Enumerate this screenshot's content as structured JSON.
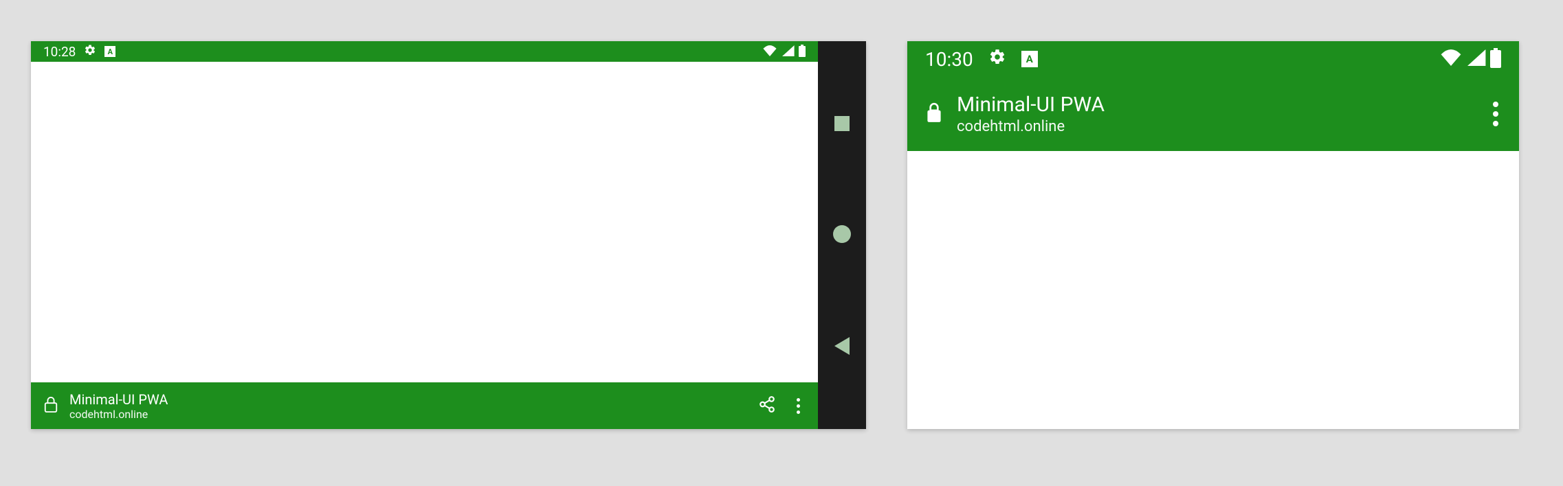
{
  "colors": {
    "theme": "#1d8e1d",
    "navbar": "#1c1c1c",
    "navbtn": "#a8c8a8"
  },
  "left_device": {
    "status": {
      "time": "10:28"
    },
    "content": "",
    "bottom_bar": {
      "title": "Minimal-UI PWA",
      "host": "codehtml.online"
    },
    "nav_buttons": [
      "overview",
      "home",
      "back"
    ]
  },
  "right_device": {
    "status": {
      "time": "10:30"
    },
    "app_bar": {
      "title": "Minimal-UI PWA",
      "host": "codehtml.online"
    },
    "content": ""
  },
  "icons": {
    "gear": "gear-icon",
    "badge": "A",
    "wifi": "wifi-icon",
    "signal": "signal-icon",
    "battery": "battery-icon",
    "lock_outline": "lock-outline-icon",
    "lock_fill": "lock-fill-icon",
    "share": "share-icon",
    "more": "more-vert-icon"
  }
}
